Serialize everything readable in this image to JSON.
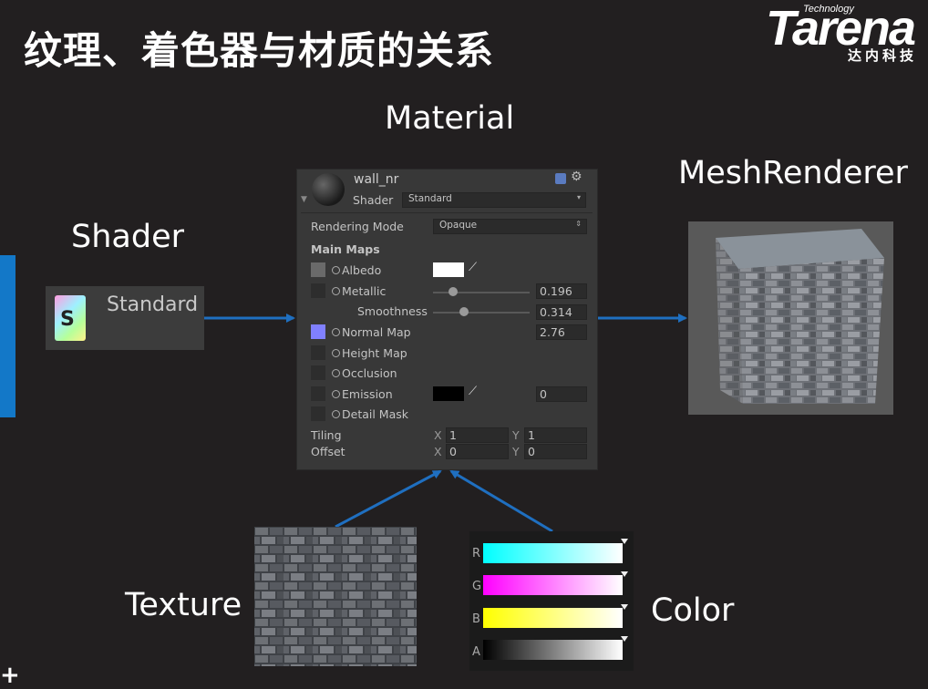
{
  "slide": {
    "title": "纹理、着色器与材质的关系",
    "logo": {
      "word": "Tarena",
      "tech": "Technology",
      "cn": "达内科技"
    },
    "plus": "+"
  },
  "labels": {
    "material": "Material",
    "shader": "Shader",
    "mesh_renderer": "MeshRenderer",
    "texture": "Texture",
    "color": "Color"
  },
  "shader_box": {
    "text": "Standard",
    "icon_letter": "S"
  },
  "inspector": {
    "material_name": "wall_nr",
    "shader_label": "Shader",
    "shader_value": "Standard",
    "rendering_mode_label": "Rendering Mode",
    "rendering_mode_value": "Opaque",
    "main_maps": "Main Maps",
    "albedo": "Albedo",
    "metallic": "Metallic",
    "metallic_value": "0.196",
    "smoothness": "Smoothness",
    "smoothness_value": "0.314",
    "normal_map": "Normal Map",
    "normal_value": "2.76",
    "height_map": "Height Map",
    "occlusion": "Occlusion",
    "emission": "Emission",
    "emission_value": "0",
    "detail_mask": "Detail Mask",
    "tiling": "Tiling",
    "offset": "Offset",
    "x": "X",
    "y": "Y",
    "tiling_x": "1",
    "tiling_y": "1",
    "offset_x": "0",
    "offset_y": "0"
  },
  "color_picker": {
    "channels": [
      "R",
      "G",
      "B",
      "A"
    ]
  },
  "colors": {
    "arrow": "#1f6fc0",
    "accent_bar": "#1378c8",
    "background": "#221f20"
  }
}
